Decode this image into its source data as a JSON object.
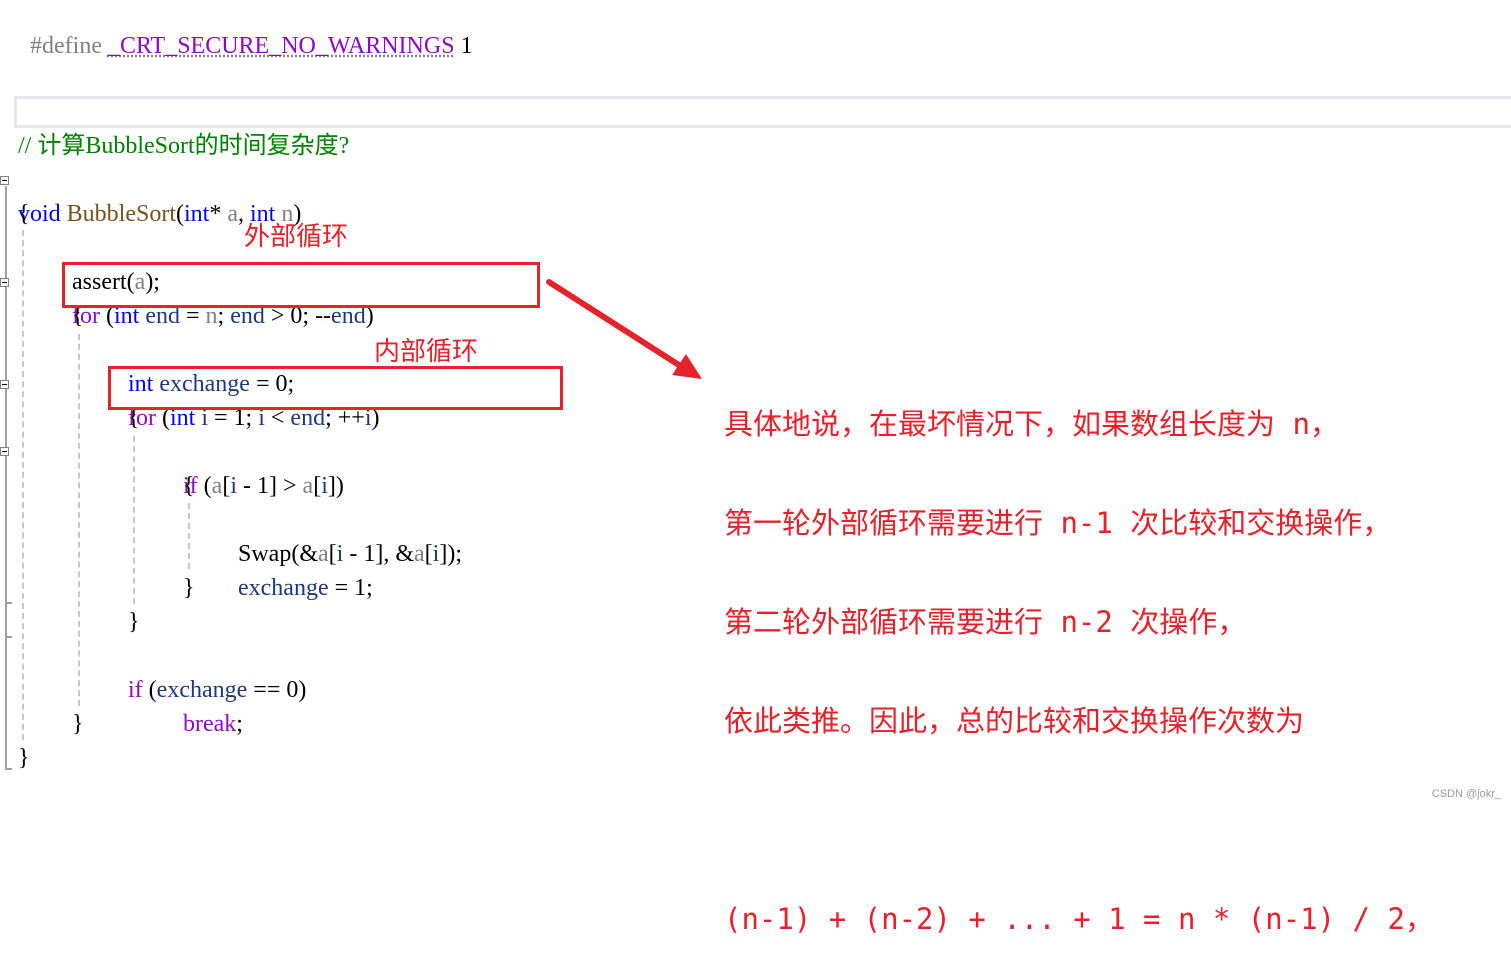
{
  "editor": {
    "lines": {
      "define_kw": "#define",
      "define_macro": "_CRT_SECURE_NO_WARNINGS",
      "define_value": "1",
      "comment": "// 计算BubbleSort的时间复杂度?",
      "sig_void": "void",
      "sig_name": "BubbleSort",
      "sig_open": "(",
      "sig_int1": "int",
      "sig_star": "*",
      "sig_a": "a",
      "sig_comma": ", ",
      "sig_int2": "int",
      "sig_n": "n",
      "sig_close": ")",
      "brace_open": "{",
      "assert_fn": "assert",
      "assert_open": "(",
      "assert_arg": "a",
      "assert_close": ");",
      "for1_kw": "for",
      "for1_open": " (",
      "for1_int": "int",
      "for1_end1": " end",
      "for1_eq": " = ",
      "for1_n": "n",
      "for1_semi": "; ",
      "for1_end2": "end",
      "for1_gt": " > 0; --",
      "for1_end3": "end",
      "for1_close": ")",
      "brace2_open": "{",
      "ex_int": "int",
      "ex_var": " exchange",
      "ex_rest": " = 0;",
      "for2_kw": "for",
      "for2_open": " (",
      "for2_int": "int",
      "for2_i1": " i",
      "for2_mid": " = 1; ",
      "for2_i2": "i",
      "for2_lt": " < ",
      "for2_end": "end",
      "for2_semi": "; ++",
      "for2_i3": "i",
      "for2_close": ")",
      "brace3_open": "{",
      "if1_kw": "if",
      "if1_open": " (",
      "if1_a1": "a",
      "if1_b1": "[",
      "if1_i1": "i",
      "if1_m": " - 1] > ",
      "if1_a2": "a",
      "if1_b2": "[",
      "if1_i2": "i",
      "if1_close": "])",
      "brace4_open": "{",
      "swap_fn": "Swap",
      "swap_open": "(&",
      "swap_a1": "a",
      "swap_b1": "[",
      "swap_i1": "i",
      "swap_m": " - 1], &",
      "swap_a2": "a",
      "swap_b2": "[",
      "swap_i2": "i",
      "swap_close": "]);",
      "ex_assign_var": "exchange",
      "ex_assign_rest": " = 1;",
      "brace4_close": "}",
      "brace3_close": "}",
      "if2_kw": "if",
      "if2_open": " (",
      "if2_var": "exchange",
      "if2_rest": " == 0)",
      "break_kw": "break",
      "break_semi": ";",
      "brace2_close": "}",
      "brace_close": "}"
    }
  },
  "annotations": {
    "outer_loop_label": "外部循环",
    "inner_loop_label": "内部循环",
    "explanation": [
      "具体地说，在最坏情况下，如果数组长度为 n，",
      "第一轮外部循环需要进行 n-1 次比较和交换操作，",
      "第二轮外部循环需要进行 n-2 次操作，",
      "依此类推。因此，总的比较和交换操作次数为",
      "",
      "(n-1) + (n-2) + ... + 1 = n * (n-1) / 2，"
    ],
    "accent_color": "#e3242b"
  },
  "watermark": "CSDN @jokr_"
}
